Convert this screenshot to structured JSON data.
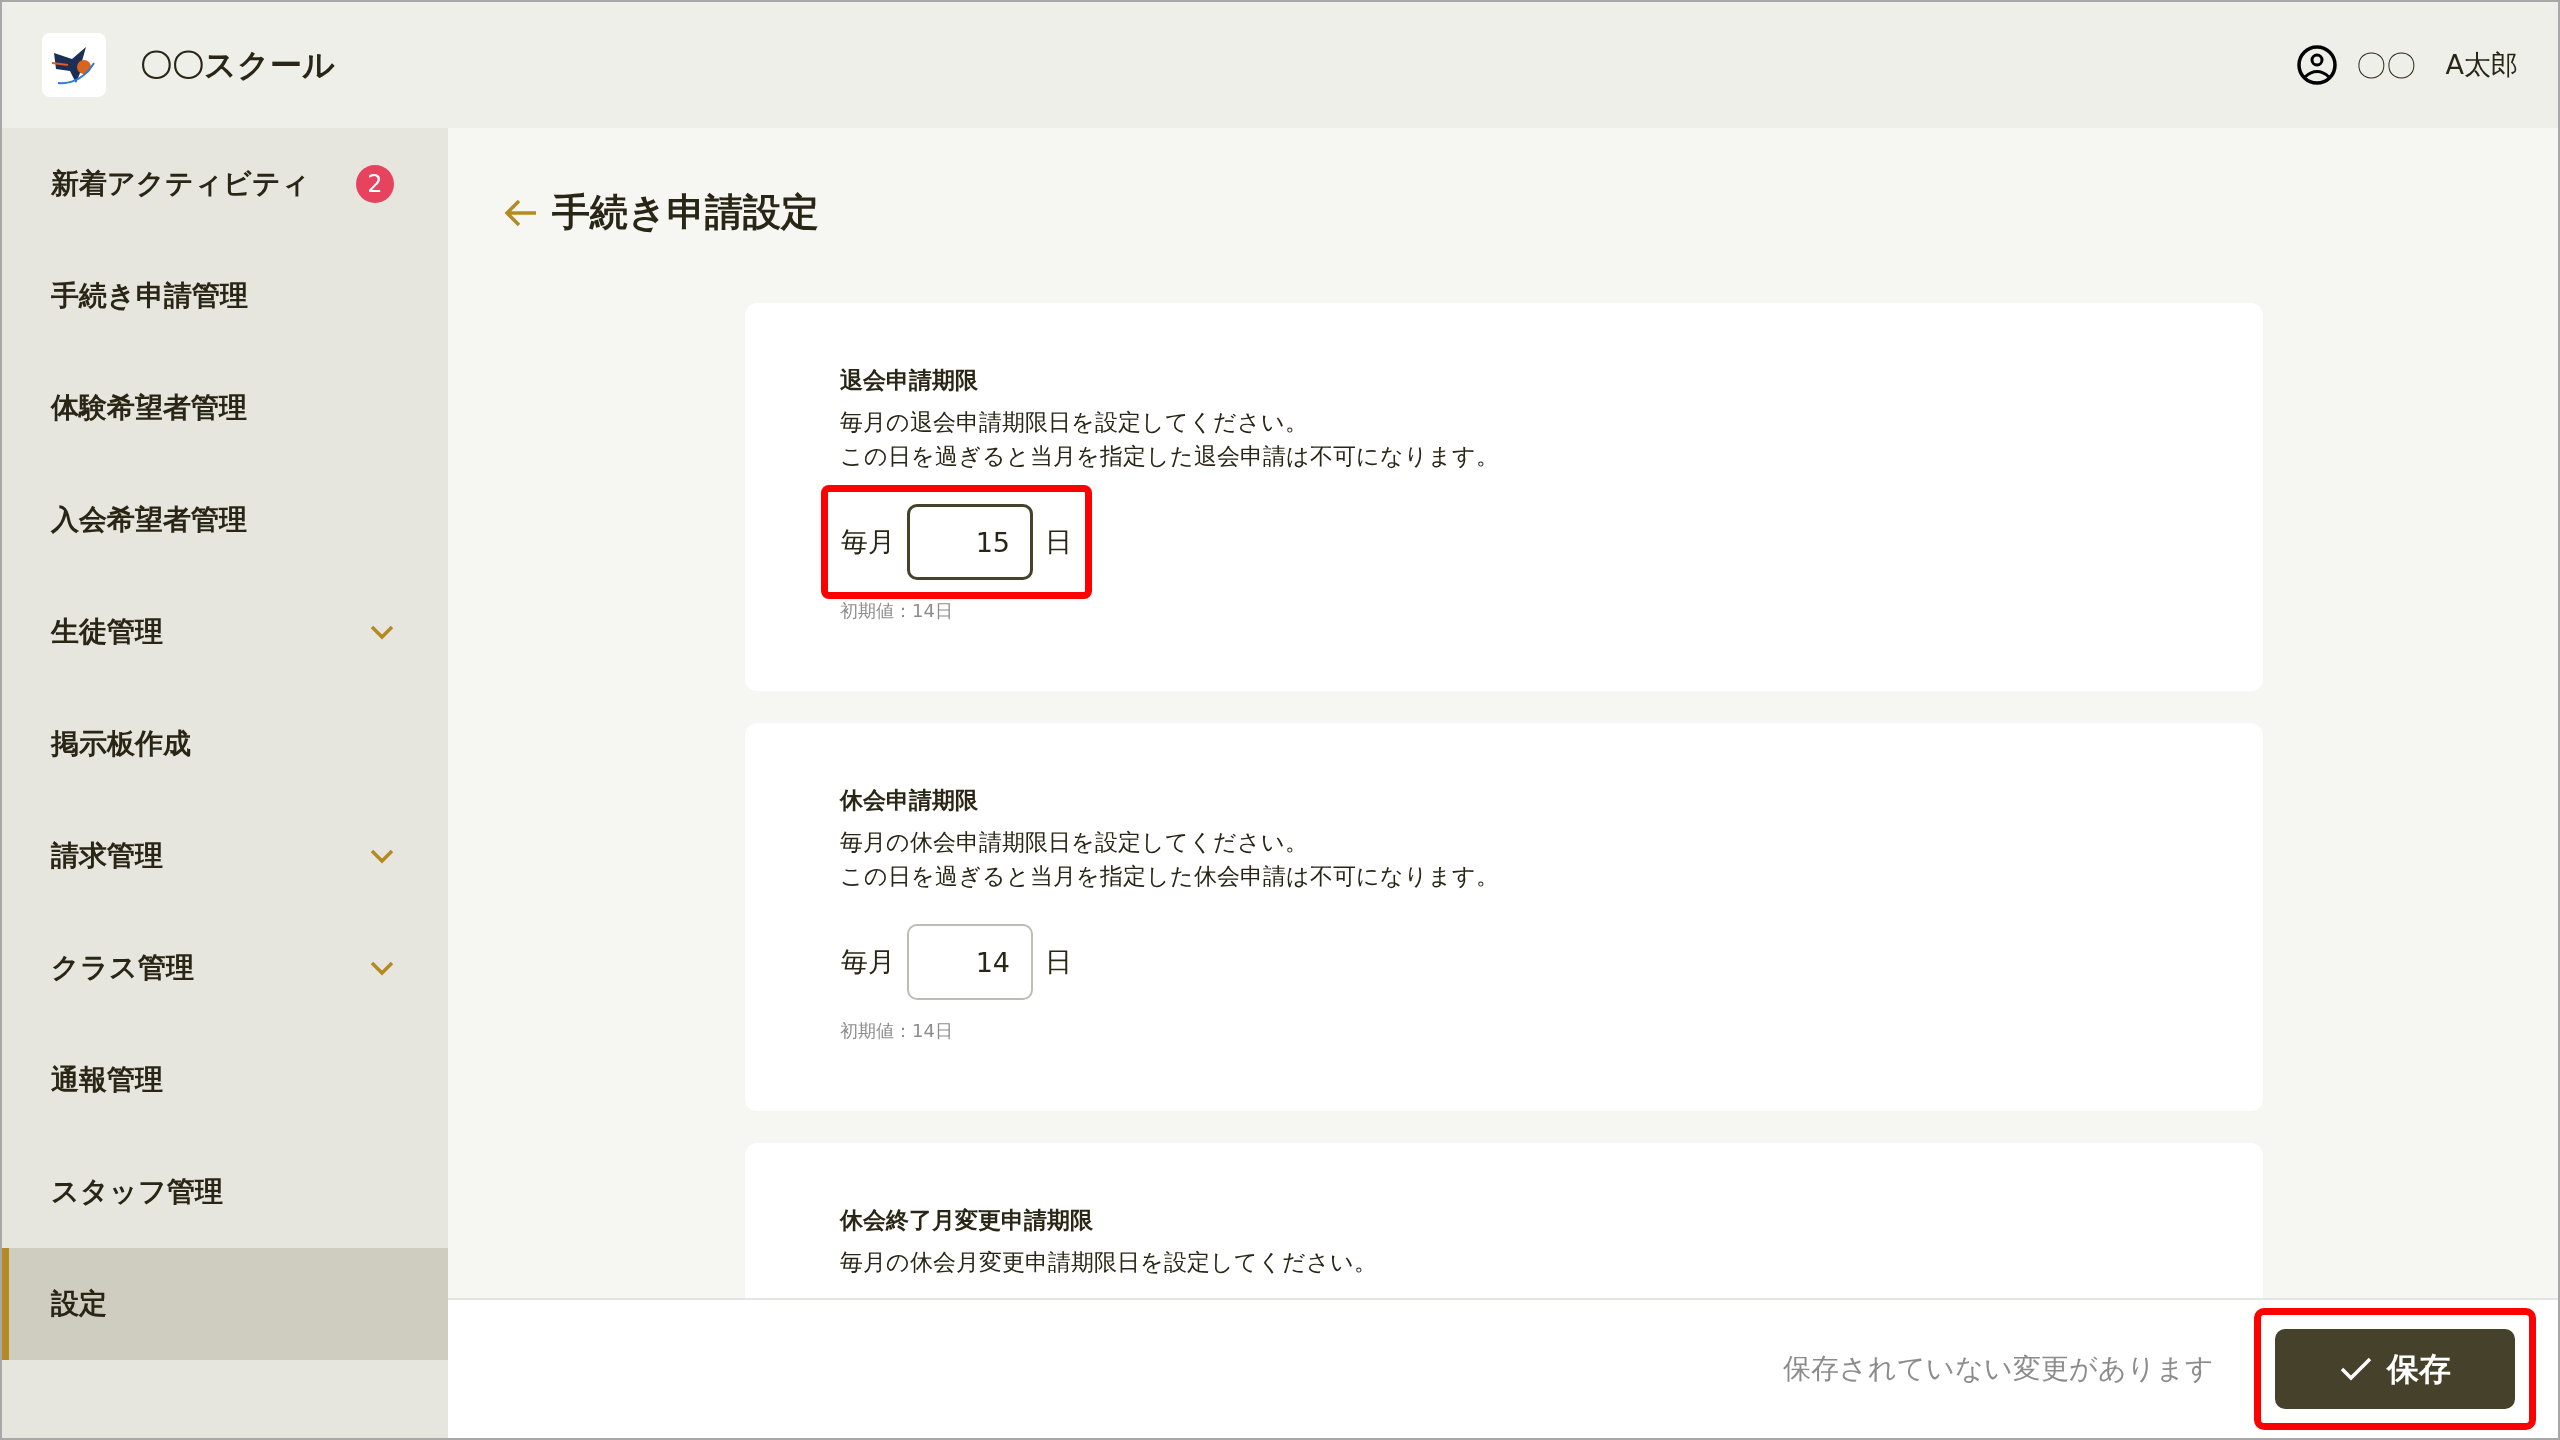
{
  "header": {
    "school_name": "〇〇スクール",
    "user_prefix": "〇〇",
    "user_name": "A太郎"
  },
  "sidebar": {
    "items": [
      {
        "label": "新着アクティビティ",
        "badge": "2",
        "expandable": false,
        "selected": false
      },
      {
        "label": "手続き申請管理",
        "expandable": false,
        "selected": false
      },
      {
        "label": "体験希望者管理",
        "expandable": false,
        "selected": false
      },
      {
        "label": "入会希望者管理",
        "expandable": false,
        "selected": false
      },
      {
        "label": "生徒管理",
        "expandable": true,
        "selected": false
      },
      {
        "label": "掲示板作成",
        "expandable": false,
        "selected": false
      },
      {
        "label": "請求管理",
        "expandable": true,
        "selected": false
      },
      {
        "label": "クラス管理",
        "expandable": true,
        "selected": false
      },
      {
        "label": "通報管理",
        "expandable": false,
        "selected": false
      },
      {
        "label": "スタッフ管理",
        "expandable": false,
        "selected": false
      },
      {
        "label": "設定",
        "expandable": false,
        "selected": true
      }
    ]
  },
  "page": {
    "title": "手続き申請設定",
    "cards": [
      {
        "title": "退会申請期限",
        "description": [
          "毎月の退会申請期限日を設定してください。",
          "この日を過ぎると当月を指定した退会申請は不可になります。"
        ],
        "prefix": "毎月",
        "value": "15",
        "suffix": "日",
        "changed": true,
        "highlighted": true,
        "default_note": "初期値：14日"
      },
      {
        "title": "休会申請期限",
        "description": [
          "毎月の休会申請期限日を設定してください。",
          "この日を過ぎると当月を指定した休会申請は不可になります。"
        ],
        "prefix": "毎月",
        "value": "14",
        "suffix": "日",
        "changed": false,
        "highlighted": false,
        "default_note": "初期値：14日"
      },
      {
        "title": "休会終了月変更申請期限",
        "description": [
          "毎月の休会月変更申請期限日を設定してください。"
        ]
      }
    ]
  },
  "footer": {
    "unsaved_message": "保存されていない変更があります",
    "save_button": {
      "label": "保存",
      "highlighted": true
    }
  }
}
